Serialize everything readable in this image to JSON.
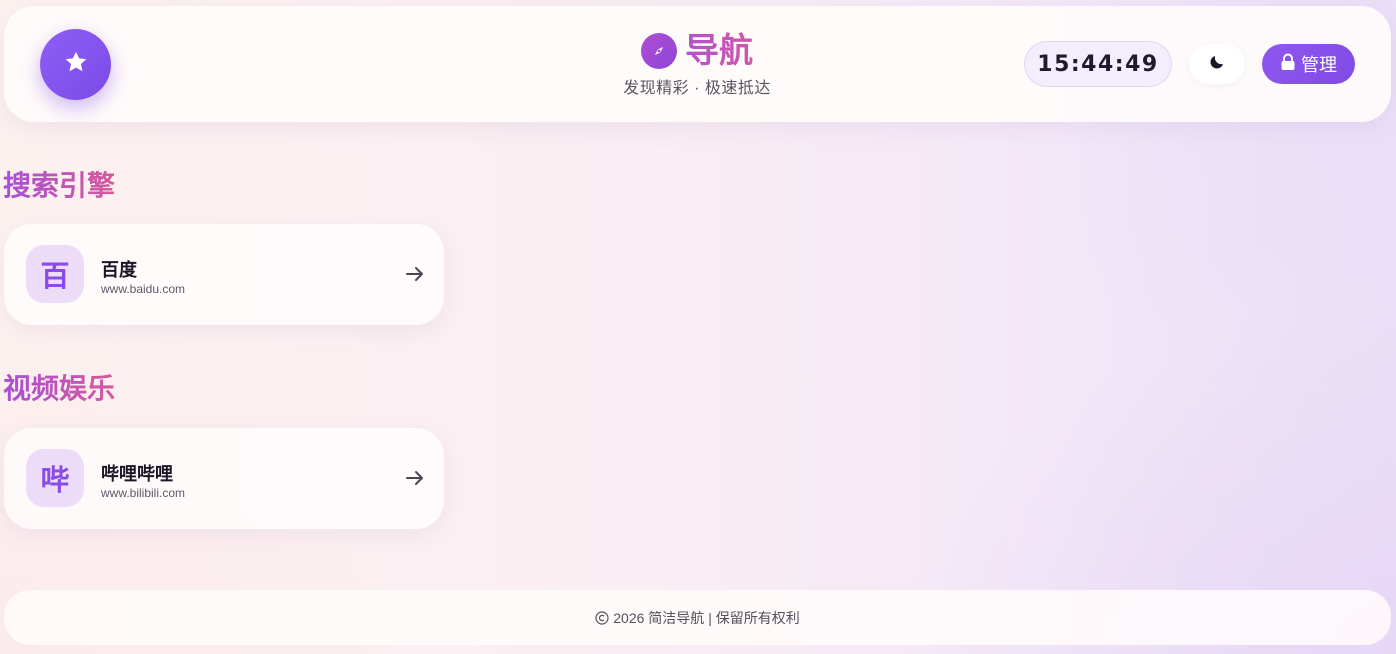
{
  "header": {
    "title": "导航",
    "subtitle": "发现精彩 · 极速抵达",
    "clock": "15:44:49",
    "admin_label": "管理"
  },
  "sections": [
    {
      "title": "搜索引擎",
      "links": [
        {
          "avatar": "百",
          "name": "百度",
          "url": "www.baidu.com"
        }
      ]
    },
    {
      "title": "视频娱乐",
      "links": [
        {
          "avatar": "哔",
          "name": "哔哩哔哩",
          "url": "www.bilibili.com"
        }
      ]
    }
  ],
  "footer": {
    "text": "2026 简洁导航 | 保留所有权利"
  },
  "colors": {
    "accent": "#8a4be6",
    "brand_gradient_start": "#b452cf",
    "brand_gradient_end": "#d058a6"
  },
  "icons": {
    "fab": "star-icon",
    "brand": "compass-icon",
    "theme": "moon-icon",
    "admin": "lock-icon",
    "card_action": "arrow-right-icon",
    "footer": "copyright-icon"
  }
}
